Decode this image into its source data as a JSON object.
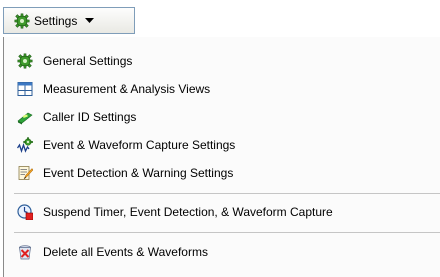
{
  "toolbar": {
    "settings_label": "Settings",
    "icon": "gear-icon",
    "dropdown_icon": "chevron-down-icon"
  },
  "menu": {
    "items": [
      {
        "label": "General Settings",
        "icon": "gear-icon"
      },
      {
        "label": "Measurement & Analysis Views",
        "icon": "window-layout-icon"
      },
      {
        "label": "Caller ID Settings",
        "icon": "caller-id-icon"
      },
      {
        "label": "Event & Waveform Capture Settings",
        "icon": "waveform-capture-icon"
      },
      {
        "label": "Event Detection & Warning Settings",
        "icon": "document-pencil-icon"
      },
      {
        "label": "Suspend Timer, Event Detection, & Waveform Capture",
        "icon": "timer-stop-icon"
      },
      {
        "label": "Delete all Events & Waveforms",
        "icon": "delete-icon"
      }
    ]
  },
  "colors": {
    "menu_background": "#fbfbfb",
    "button_border": "#7f9db9",
    "separator": "#c5c5c5"
  }
}
